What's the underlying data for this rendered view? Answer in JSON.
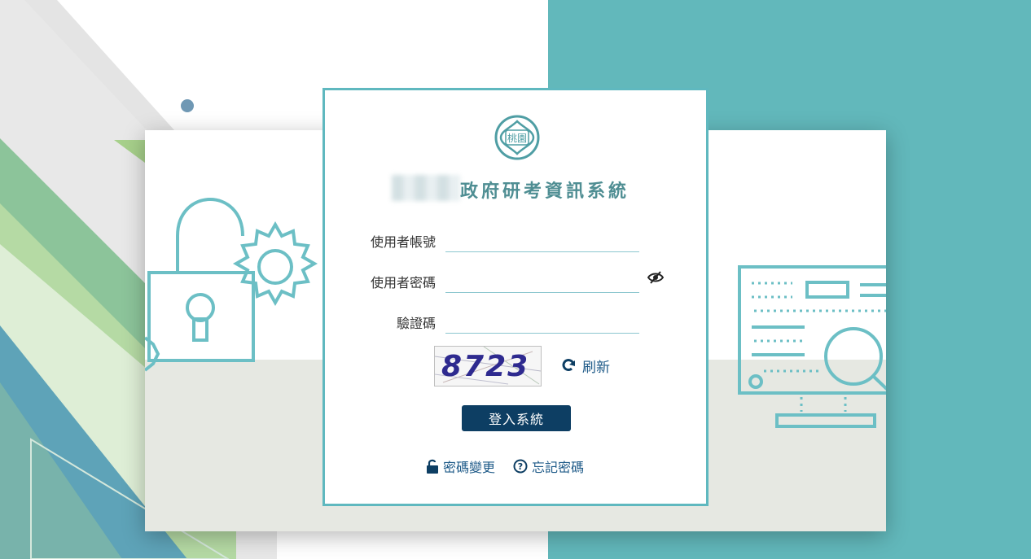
{
  "seal": {
    "text": "桃園"
  },
  "title": {
    "redacted_prefix": "",
    "main": "政府研考資訊系統"
  },
  "form": {
    "username": {
      "label": "使用者帳號",
      "value": "",
      "placeholder": ""
    },
    "password": {
      "label": "使用者密碼",
      "value": "",
      "placeholder": ""
    },
    "captcha": {
      "label": "驗證碼",
      "value": "",
      "placeholder": "",
      "image_text": "8723"
    }
  },
  "refresh_label": "刷新",
  "login_button": "登入系統",
  "links": {
    "change_password": "密碼變更",
    "forgot_password": "忘記密碼"
  },
  "icons": [
    "lock-open-icon",
    "question-circle-icon",
    "eye-slash-icon",
    "refresh-icon"
  ],
  "colors": {
    "teal": "#62b8bb",
    "button": "#0d3e63",
    "link": "#1e5a88"
  }
}
